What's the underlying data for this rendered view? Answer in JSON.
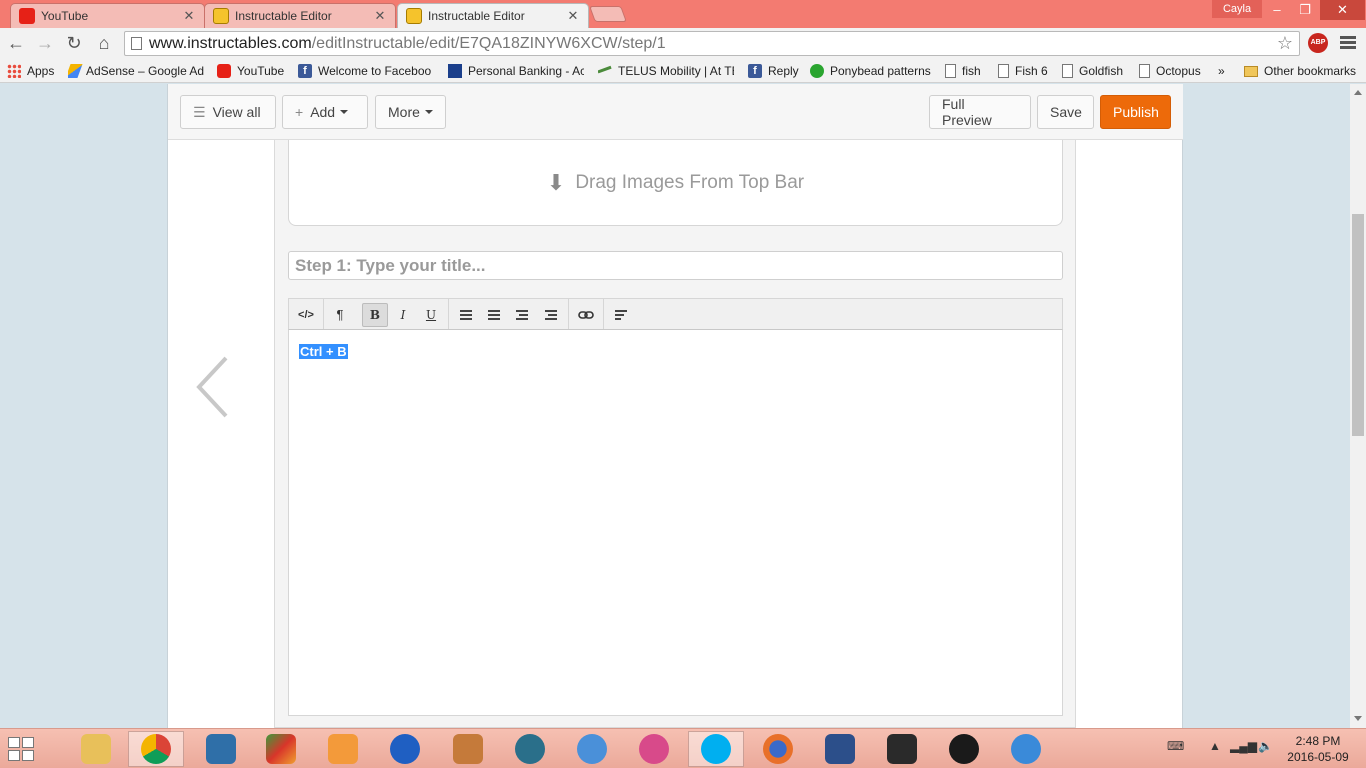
{
  "browser": {
    "tabs": [
      {
        "label": "YouTube",
        "favicon": "youtube-icon",
        "active": false
      },
      {
        "label": "Instructable Editor",
        "favicon": "instructables-robot-icon",
        "active": false
      },
      {
        "label": "Instructable Editor",
        "favicon": "instructables-robot-icon",
        "active": true
      }
    ],
    "profile_name": "Cayla",
    "url_host": "www.instructables.com",
    "url_path": "/editInstructable/edit/E7QA18ZINYW6XCW/step/1",
    "abp_label": "ABP",
    "bookmarks": [
      {
        "label": "Apps",
        "icon": "apps-grid-icon"
      },
      {
        "label": "AdSense – Google Ad",
        "icon": "adsense-icon"
      },
      {
        "label": "YouTube",
        "icon": "youtube-icon"
      },
      {
        "label": "Welcome to Faceboo",
        "icon": "facebook-icon"
      },
      {
        "label": "Personal Banking - Ac",
        "icon": "rbc-icon"
      },
      {
        "label": "TELUS Mobility | At TE",
        "icon": "telus-icon"
      },
      {
        "label": "Reply",
        "icon": "facebook-icon"
      },
      {
        "label": "Ponybead patterns",
        "icon": "green-circle-icon"
      },
      {
        "label": "fish",
        "icon": "page-icon"
      },
      {
        "label": "Fish 6",
        "icon": "page-icon"
      },
      {
        "label": "Goldfish",
        "icon": "page-icon"
      },
      {
        "label": "Octopus",
        "icon": "page-icon"
      }
    ],
    "bookmarks_overflow": "»",
    "other_bookmarks": "Other bookmarks"
  },
  "editor": {
    "view_all": "View all",
    "add": "Add",
    "more": "More",
    "full_preview": "Full Preview",
    "save": "Save",
    "publish": "Publish",
    "drop_text": "Drag Images From Top Bar",
    "step_title_placeholder": "Step 1:  Type your title...",
    "body_text": "Ctrl + B",
    "rte_buttons": [
      "</>",
      "¶",
      "B",
      "I",
      "U"
    ]
  },
  "taskbar": {
    "time": "2:48 PM",
    "date": "2016-05-09"
  },
  "colors": {
    "tabstrip": "#f37b71",
    "publish": "#ed6a0a",
    "selection": "#3390ff",
    "page_bg": "#d6e3ea"
  }
}
